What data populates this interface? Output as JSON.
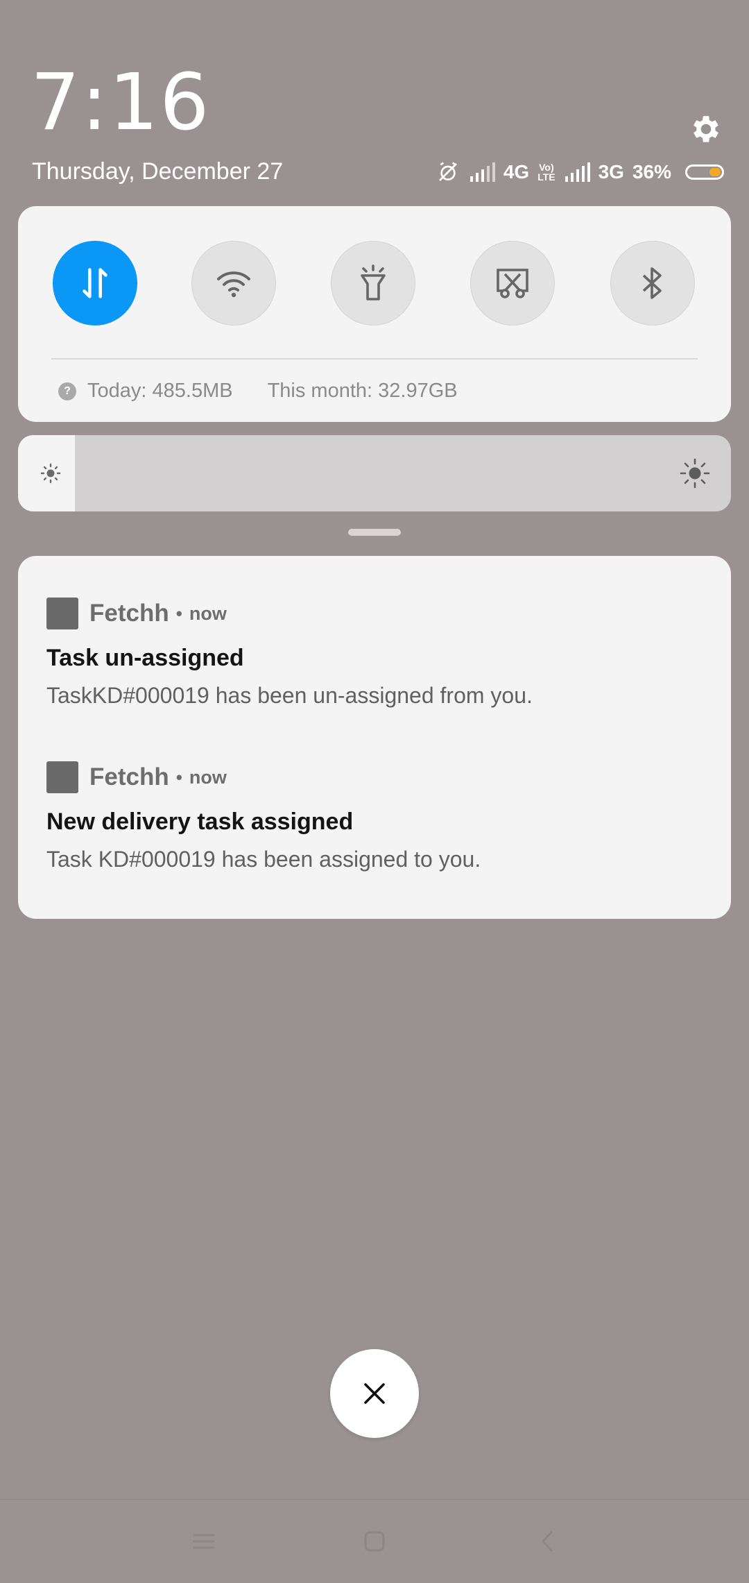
{
  "header": {
    "time": "7:16",
    "date": "Thursday, December 27"
  },
  "status": {
    "network1": "4G",
    "volte_top": "Vo)",
    "volte_bottom": "LTE",
    "network2": "3G",
    "battery_percent": "36%",
    "battery_level": 0.36,
    "battery_color": "#f5a623"
  },
  "quick_settings": {
    "toggles": [
      {
        "name": "mobile-data",
        "icon": "data-arrows-icon",
        "active": true
      },
      {
        "name": "wifi",
        "icon": "wifi-icon",
        "active": false
      },
      {
        "name": "flashlight",
        "icon": "flashlight-icon",
        "active": false
      },
      {
        "name": "screenshot",
        "icon": "scissors-icon",
        "active": false
      },
      {
        "name": "bluetooth",
        "icon": "bluetooth-icon",
        "active": false
      }
    ],
    "active_color": "#0a97f5",
    "help_glyph": "?",
    "usage_today": "Today: 485.5MB",
    "usage_month": "This month: 32.97GB"
  },
  "brightness": {
    "level": 0.08
  },
  "notifications": [
    {
      "app": "Fetchh",
      "separator": "•",
      "time": "now",
      "title": "Task un-assigned",
      "body": "TaskKD#000019 has been un-assigned from you."
    },
    {
      "app": "Fetchh",
      "separator": "•",
      "time": "now",
      "title": "New delivery task assigned",
      "body": "Task KD#000019 has been assigned to you."
    }
  ]
}
